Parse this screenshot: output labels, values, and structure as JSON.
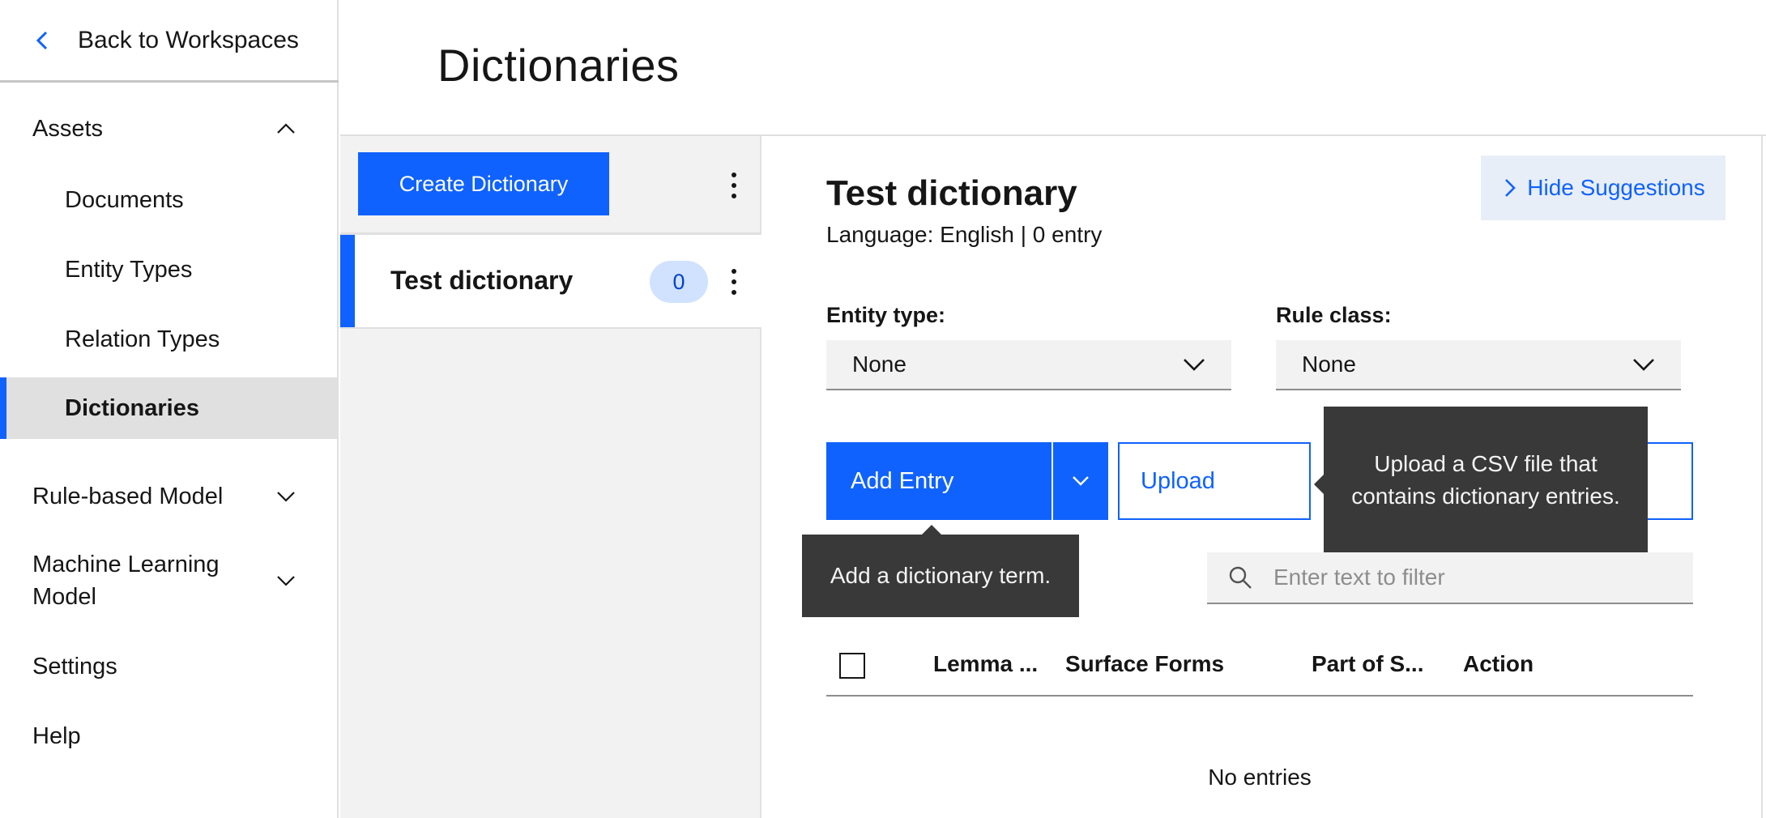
{
  "sidebar": {
    "back_label": "Back to Workspaces",
    "assets_label": "Assets",
    "assets_items": [
      "Documents",
      "Entity Types",
      "Relation Types",
      "Dictionaries"
    ],
    "rule_model_label": "Rule-based Model",
    "ml_model_label_line1": "Machine Learning",
    "ml_model_label_line2": "Model",
    "settings_label": "Settings",
    "help_label": "Help",
    "active_item": "Dictionaries"
  },
  "header": {
    "title": "Dictionaries"
  },
  "list": {
    "create_label": "Create Dictionary",
    "items": [
      {
        "name": "Test dictionary",
        "count": "0"
      }
    ]
  },
  "detail": {
    "title": "Test dictionary",
    "meta": "Language: English | 0 entry",
    "hide_suggestions_label": "Hide Suggestions",
    "entity_type_label": "Entity type:",
    "entity_type_value": "None",
    "rule_class_label": "Rule class:",
    "rule_class_value": "None",
    "add_entry_label": "Add Entry",
    "upload_label": "Upload",
    "upload_tooltip": "Upload a CSV file that contains dictionary entries.",
    "add_entry_tooltip": "Add a dictionary term.",
    "filter_placeholder": "Enter text to filter",
    "columns": [
      "Lemma ...",
      "Surface Forms",
      "Part of S...",
      "Action"
    ],
    "empty_message": "No entries"
  },
  "colors": {
    "accent": "#0f62fe",
    "tooltip_bg": "#393939",
    "sidebar_active_bg": "#e0e0e0",
    "count_badge_bg": "#d0e2ff"
  },
  "icons": {
    "back": "chevron-left-icon",
    "collapse": "chevron-up-icon",
    "expand": "chevron-down-icon",
    "menu": "overflow-menu-vertical-icon",
    "search": "search-icon",
    "suggestions": "chevron-right-icon"
  }
}
